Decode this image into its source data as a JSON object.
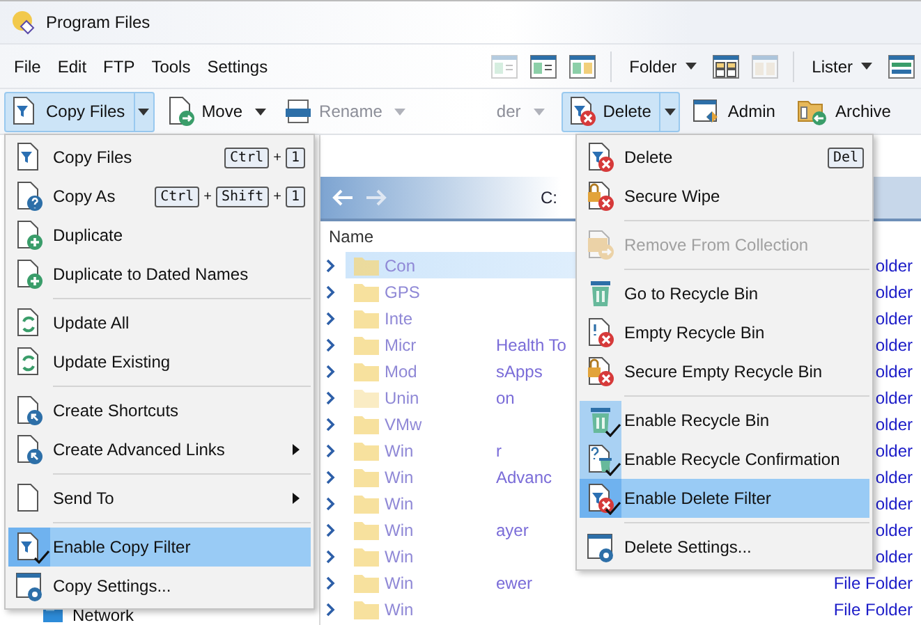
{
  "window": {
    "title": "Program Files"
  },
  "menu_bar": [
    "File",
    "Edit",
    "FTP",
    "Tools",
    "Settings"
  ],
  "view_toolbar": {
    "dropdowns": [
      "Folder",
      "Lister"
    ]
  },
  "toolbar": [
    {
      "label": "Copy Files",
      "kind": "split",
      "active": true,
      "faded": false
    },
    {
      "label": "Move",
      "kind": "dropdown",
      "active": false,
      "faded": false
    },
    {
      "label": "Rename",
      "kind": "dropdown",
      "active": false,
      "faded": true
    },
    {
      "label": "der",
      "kind": "dropdown",
      "active": false,
      "faded": true
    },
    {
      "label": "Delete",
      "kind": "split",
      "active": true,
      "faded": false
    },
    {
      "label": "Admin",
      "kind": "plain",
      "active": false,
      "faded": false
    },
    {
      "label": "Archive",
      "kind": "plain",
      "active": false,
      "faded": false
    }
  ],
  "path_bar": {
    "crumb": "C:"
  },
  "file_list": {
    "column_1": "Name",
    "rows": [
      {
        "name": "Con",
        "detail": "",
        "type": "older"
      },
      {
        "name": "GPS",
        "detail": "",
        "type": "older"
      },
      {
        "name": "Inte",
        "detail": "",
        "type": "older"
      },
      {
        "name": "Micr",
        "detail": "Health To",
        "type": "older"
      },
      {
        "name": "Mod",
        "detail": "sApps",
        "type": "older"
      },
      {
        "name": "Unin",
        "detail": "on",
        "type": "older"
      },
      {
        "name": "VMw",
        "detail": "",
        "type": "older"
      },
      {
        "name": "Win",
        "detail": "r",
        "type": "older"
      },
      {
        "name": "Win",
        "detail": "Advanc",
        "type": "older"
      },
      {
        "name": "Win",
        "detail": "",
        "type": "older"
      },
      {
        "name": "Win",
        "detail": "ayer",
        "type": "older"
      },
      {
        "name": "Win",
        "detail": "",
        "type": "older"
      },
      {
        "name": "Win",
        "detail": "ewer",
        "type": "File Folder"
      },
      {
        "name": "Win",
        "detail": "",
        "type": "File Folder"
      }
    ]
  },
  "tree": {
    "items": [
      "Network"
    ]
  },
  "copy_menu": [
    {
      "kind": "item",
      "label": "Copy Files",
      "keys": [
        {
          "kind": "key",
          "text": "Ctrl"
        },
        {
          "kind": "plus",
          "text": "+"
        },
        {
          "kind": "key",
          "text": "1"
        }
      ],
      "checked": false,
      "selected": false,
      "disabled": false,
      "submenu": false
    },
    {
      "kind": "item",
      "label": "Copy As",
      "keys": [
        {
          "kind": "key",
          "text": "Ctrl"
        },
        {
          "kind": "plus",
          "text": "+"
        },
        {
          "kind": "key",
          "text": "Shift"
        },
        {
          "kind": "plus",
          "text": "+"
        },
        {
          "kind": "key",
          "text": "1"
        }
      ],
      "checked": false,
      "selected": false,
      "disabled": false,
      "submenu": false
    },
    {
      "kind": "item",
      "label": "Duplicate",
      "checked": false,
      "selected": false,
      "disabled": false,
      "submenu": false
    },
    {
      "kind": "item",
      "label": "Duplicate to Dated Names",
      "checked": false,
      "selected": false,
      "disabled": false,
      "submenu": false
    },
    {
      "kind": "separator"
    },
    {
      "kind": "item",
      "label": "Update All",
      "checked": false,
      "selected": false,
      "disabled": false,
      "submenu": false
    },
    {
      "kind": "item",
      "label": "Update Existing",
      "checked": false,
      "selected": false,
      "disabled": false,
      "submenu": false
    },
    {
      "kind": "separator"
    },
    {
      "kind": "item",
      "label": "Create Shortcuts",
      "checked": false,
      "selected": false,
      "disabled": false,
      "submenu": false
    },
    {
      "kind": "item",
      "label": "Create Advanced Links",
      "checked": false,
      "selected": false,
      "disabled": false,
      "submenu": true
    },
    {
      "kind": "separator"
    },
    {
      "kind": "item",
      "label": "Send To",
      "checked": false,
      "selected": false,
      "disabled": false,
      "submenu": true
    },
    {
      "kind": "separator"
    },
    {
      "kind": "item",
      "label": "Enable Copy Filter",
      "checked": true,
      "selected": true,
      "disabled": false,
      "submenu": false
    },
    {
      "kind": "item",
      "label": "Copy Settings...",
      "checked": false,
      "selected": false,
      "disabled": false,
      "submenu": false
    }
  ],
  "delete_menu": [
    {
      "kind": "item",
      "label": "Delete",
      "keys": [
        {
          "kind": "key",
          "text": "Del"
        }
      ],
      "checked": false,
      "selected": false,
      "disabled": false,
      "submenu": false
    },
    {
      "kind": "item",
      "label": "Secure Wipe",
      "checked": false,
      "selected": false,
      "disabled": false,
      "submenu": false
    },
    {
      "kind": "separator"
    },
    {
      "kind": "item",
      "label": "Remove From Collection",
      "checked": false,
      "selected": false,
      "disabled": true,
      "submenu": false
    },
    {
      "kind": "separator"
    },
    {
      "kind": "item",
      "label": "Go to Recycle Bin",
      "checked": false,
      "selected": false,
      "disabled": false,
      "submenu": false
    },
    {
      "kind": "item",
      "label": "Empty Recycle Bin",
      "checked": false,
      "selected": false,
      "disabled": false,
      "submenu": false
    },
    {
      "kind": "item",
      "label": "Secure Empty Recycle Bin",
      "checked": false,
      "selected": false,
      "disabled": false,
      "submenu": false
    },
    {
      "kind": "separator"
    },
    {
      "kind": "item",
      "label": "Enable Recycle Bin",
      "checked": true,
      "selected": false,
      "disabled": false,
      "submenu": false
    },
    {
      "kind": "item",
      "label": "Enable Recycle Confirmation",
      "checked": true,
      "selected": false,
      "disabled": false,
      "submenu": false
    },
    {
      "kind": "item",
      "label": "Enable Delete Filter",
      "checked": true,
      "selected": true,
      "disabled": false,
      "submenu": false
    },
    {
      "kind": "separator"
    },
    {
      "kind": "item",
      "label": "Delete Settings...",
      "checked": false,
      "selected": false,
      "disabled": false,
      "submenu": false
    }
  ]
}
